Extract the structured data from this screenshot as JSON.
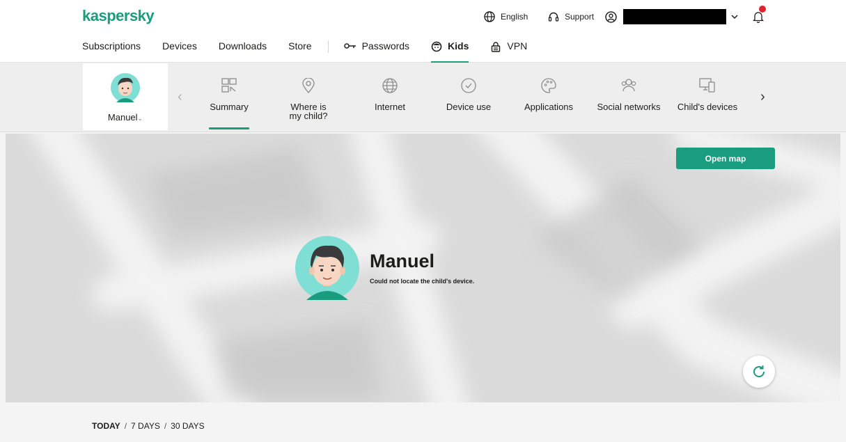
{
  "brand": {
    "logo_text": "kaspersky",
    "accent": "#1a9c7f"
  },
  "topbar": {
    "language": "English",
    "support": "Support",
    "account_name": "",
    "notification_dot": "#e0222c"
  },
  "nav": {
    "items": [
      {
        "label": "Subscriptions",
        "icon": ""
      },
      {
        "label": "Devices",
        "icon": ""
      },
      {
        "label": "Downloads",
        "icon": ""
      },
      {
        "label": "Store",
        "icon": ""
      },
      {
        "label": "Passwords",
        "icon": "key-icon"
      },
      {
        "label": "Kids",
        "icon": "kids-icon",
        "active": true
      },
      {
        "label": "VPN",
        "icon": "vpn-lock-icon"
      }
    ]
  },
  "child_selector": {
    "name": "Manuel"
  },
  "tabs": [
    {
      "label": "Summary",
      "icon": "summary-icon",
      "active": true
    },
    {
      "label": "Where is my child?",
      "icon": "location-pin-icon"
    },
    {
      "label": "Internet",
      "icon": "globe-icon"
    },
    {
      "label": "Device use",
      "icon": "clock-icon"
    },
    {
      "label": "Applications",
      "icon": "palette-icon"
    },
    {
      "label": "Social networks",
      "icon": "people-icon"
    },
    {
      "label": "Child's devices",
      "icon": "devices-icon"
    }
  ],
  "map": {
    "open_map_label": "Open map",
    "child_name": "Manuel",
    "status_text": "Could not locate the child's device."
  },
  "period": {
    "today": "TODAY",
    "seven_days": "7 DAYS",
    "thirty_days": "30 DAYS",
    "separator": "/"
  }
}
